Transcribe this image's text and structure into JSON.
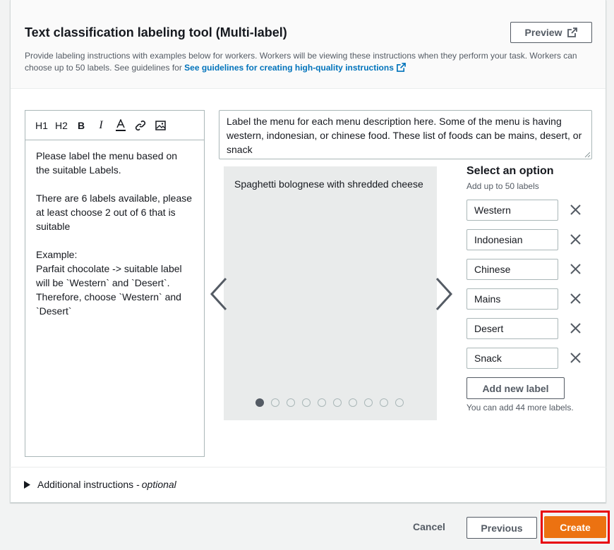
{
  "tool": {
    "title": "Text classification labeling tool (Multi-label)",
    "description_text": "Provide labeling instructions with examples below for workers. Workers will be viewing these instructions when they perform your task. Workers can choose up to 50 labels. See guidelines for ",
    "description_link": "See guidelines for creating high-quality instructions",
    "preview_label": "Preview"
  },
  "editor": {
    "toolbar": [
      "H1",
      "H2",
      "B",
      "I",
      "A",
      "link",
      "image"
    ],
    "content": "Please label the menu based on the suitable Labels.\n\nThere are 6 labels available, please at least choose 2 out of 6 that is suitable\n\nExample:\nParfait chocolate -> suitable label will be `Western` and `Desert`. Therefore, choose `Western` and `Desert`"
  },
  "header_input": {
    "value": "Label the menu for each menu description here. Some of the menu is having western, indonesian, or chinese food. These list of foods can be mains, desert, or snack"
  },
  "carousel": {
    "sample_text": "Spaghetti bolognese with shredded cheese",
    "page_count": 10,
    "active_page": 1
  },
  "options": {
    "title": "Select an option",
    "subtitle": "Add up to 50 labels",
    "labels": [
      "Western",
      "Indonesian",
      "Chinese",
      "Mains",
      "Desert",
      "Snack"
    ],
    "add_label": "Add new label",
    "hint": "You can add 44 more labels."
  },
  "additional": {
    "label": "Additional instructions - ",
    "optional": "optional"
  },
  "footer": {
    "cancel": "Cancel",
    "previous": "Previous",
    "create": "Create"
  },
  "colors": {
    "accent": "#ec7211",
    "link": "#0073bb",
    "highlight": "#e8000b"
  }
}
